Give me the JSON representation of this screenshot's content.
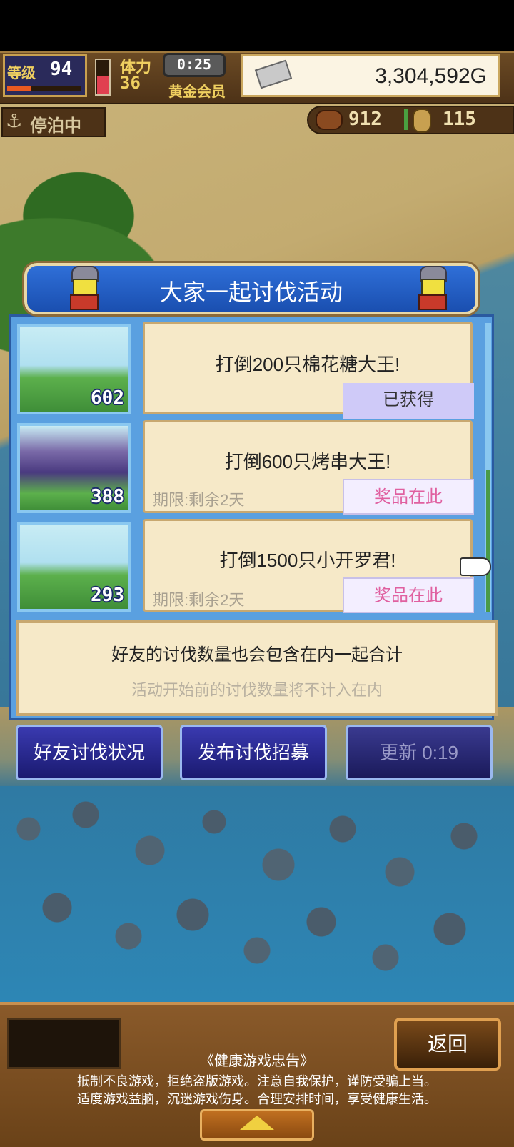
{
  "hud": {
    "level_label": "等级",
    "level": "94",
    "exp_fraction": 0.33,
    "stamina_label": "体力",
    "stamina": "36",
    "stamina_fraction": 0.52,
    "timer": "0:25",
    "membership": "黄金会员",
    "money": "3,304,592G",
    "moored": "停泊中",
    "meat": "912",
    "coin": "115"
  },
  "event": {
    "title": "大家一起讨伐活动",
    "quests": [
      {
        "count": "602",
        "title": "打倒200只棉花糖大王!",
        "deadline": "",
        "button": "已获得"
      },
      {
        "count": "388",
        "title": "打倒600只烤串大王!",
        "deadline": "期限:剩余2天",
        "button": "奖品在此"
      },
      {
        "count": "293",
        "title": "打倒1500只小开罗君!",
        "deadline": "期限:剩余2天",
        "button": "奖品在此"
      }
    ],
    "info_line1": "好友的讨伐数量也会包含在内一起合计",
    "info_line2": "活动开始前的讨伐数量将不计入在内"
  },
  "buttons": {
    "friend_status": "好友讨伐状况",
    "publish_recruit": "发布讨伐招募",
    "refresh": "更新 0:19"
  },
  "footer": {
    "return": "返回",
    "health_title": "《健康游戏忠告》",
    "health_line1": "抵制不良游戏，拒绝盗版游戏。注意自我保护，谨防受骗上当。",
    "health_line2": "适度游戏益脑，沉迷游戏伤身。合理安排时间，享受健康生活。"
  },
  "colors": {
    "panel_blue": "#5aa0e0",
    "card_bg": "#f6e9c8",
    "prize_text": "#e060a0",
    "obtained_bg": "#cfcaf8"
  }
}
